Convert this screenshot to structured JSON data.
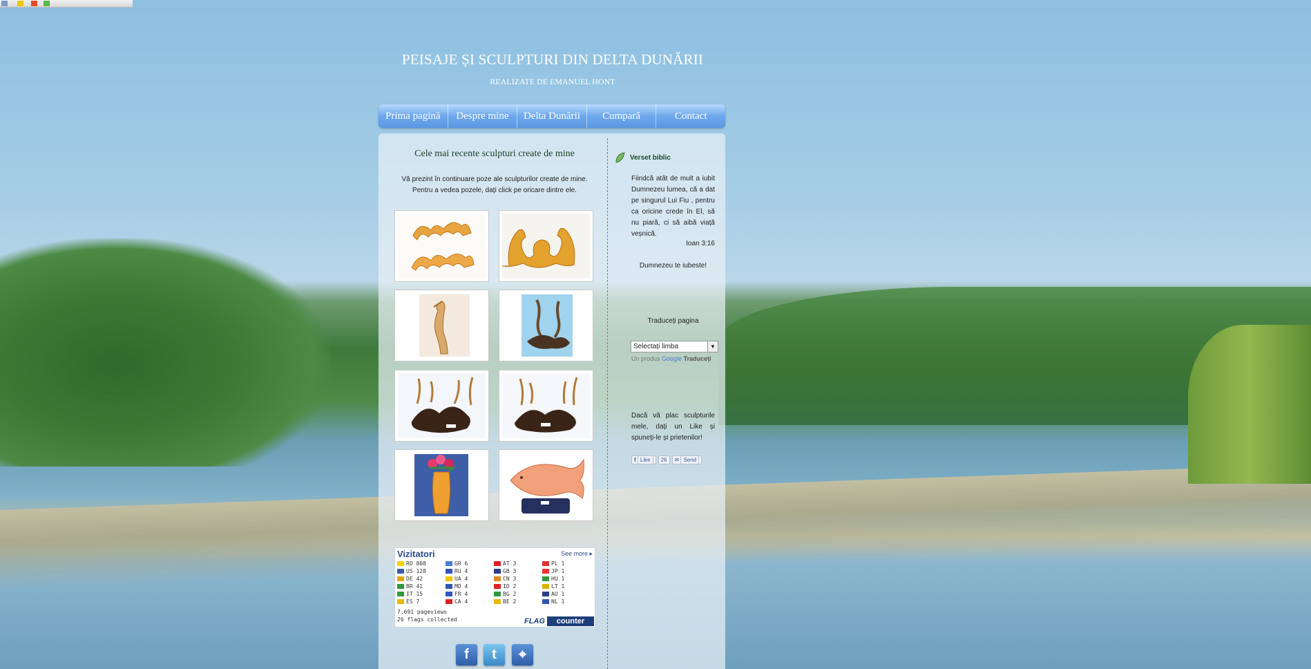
{
  "header": {
    "title": "PEISAJE ȘI SCULPTURI DIN DELTA DUNĂRII",
    "subtitle": "REALIZATE DE EMANUEL HONT"
  },
  "nav": {
    "items": [
      "Prima pagină",
      "Despre mine",
      "Delta Dunării",
      "Cumpară",
      "Contact"
    ]
  },
  "main": {
    "title": "Cele mai recente sculpturi create de mine",
    "intro_line1": "Vă prezint în continuare poze ale sculpturilor create de mine.",
    "intro_line2": "Pentru a vedea pozele, dați click pe oricare dintre ele."
  },
  "gallery": {
    "thumbnails": [
      "carved-scroll-ornaments",
      "carved-acanthus-ornament",
      "heron-sculpture",
      "heron-pair-on-driftwood",
      "herons-on-root-1",
      "herons-on-root-2",
      "flower-vase",
      "carved-fish"
    ]
  },
  "visitors": {
    "title": "Vizitatori",
    "see_more": "See more",
    "columns": [
      [
        {
          "code": "RO",
          "count": "808",
          "flag": "#f4d000"
        },
        {
          "code": "US",
          "count": "128",
          "flag": "#3c5aa8"
        },
        {
          "code": "DE",
          "count": "42",
          "flag": "#e0a800"
        },
        {
          "code": "BR",
          "count": "41",
          "flag": "#2b9a3c"
        },
        {
          "code": "IT",
          "count": "15",
          "flag": "#2e9a3a"
        },
        {
          "code": "ES",
          "count": "7",
          "flag": "#e8b800"
        }
      ],
      [
        {
          "code": "GR",
          "count": "6",
          "flag": "#4b7fd0"
        },
        {
          "code": "RU",
          "count": "4",
          "flag": "#3355bb"
        },
        {
          "code": "UA",
          "count": "4",
          "flag": "#f2c500"
        },
        {
          "code": "MD",
          "count": "4",
          "flag": "#2e55b0"
        },
        {
          "code": "FR",
          "count": "4",
          "flag": "#3355bb"
        },
        {
          "code": "CA",
          "count": "4",
          "flag": "#d22"
        }
      ],
      [
        {
          "code": "AT",
          "count": "3",
          "flag": "#d22"
        },
        {
          "code": "GB",
          "count": "3",
          "flag": "#2a3f8a"
        },
        {
          "code": "CN",
          "count": "3",
          "flag": "#d82"
        },
        {
          "code": "ID",
          "count": "2",
          "flag": "#d22"
        },
        {
          "code": "BG",
          "count": "2",
          "flag": "#2e9a3a"
        },
        {
          "code": "BE",
          "count": "2",
          "flag": "#e8b800"
        }
      ],
      [
        {
          "code": "PL",
          "count": "1",
          "flag": "#d33"
        },
        {
          "code": "JP",
          "count": "1",
          "flag": "#e33"
        },
        {
          "code": "HU",
          "count": "1",
          "flag": "#2e9a3a"
        },
        {
          "code": "LT",
          "count": "1",
          "flag": "#d9b400"
        },
        {
          "code": "AU",
          "count": "1",
          "flag": "#2a3f8a"
        },
        {
          "code": "NL",
          "count": "1",
          "flag": "#2e55b0"
        }
      ]
    ],
    "pageviews": "7,691 pageviews",
    "flags_collected": "26 flags collected",
    "logo_flag": "FLAG",
    "logo_counter": "counter"
  },
  "social": {
    "facebook": "f",
    "twitter": "t",
    "location": "⌖"
  },
  "sidebar": {
    "verse_title": "Verset biblic",
    "verse_text": "Fiindcă atât de mult a iubit Dumnezeu lumea, că a dat pe singurul Lui Fiu , pentru ca oricine crede în El, să nu piară, ci să aibă viață veșnică.",
    "verse_ref": "Ioan 3:16",
    "god_loves": "Dumnezeu te iubeste!",
    "translate_title": "Traduceți pagina",
    "translate_select": "Selectați limba",
    "translate_powered_prefix": "Un produs",
    "translate_powered_google": "Google",
    "translate_powered_suffix": "Traduceți",
    "like_text": "Dacă vă plac sculpturile mele, dați un Like și spuneți-le și prietenilor!",
    "fb_like": "Like",
    "fb_count": "26",
    "fb_send": "Send"
  },
  "colors": {
    "nav_blue": "#6ea8ec",
    "title_green": "#1d3b23",
    "counter_blue": "#294b8c"
  }
}
